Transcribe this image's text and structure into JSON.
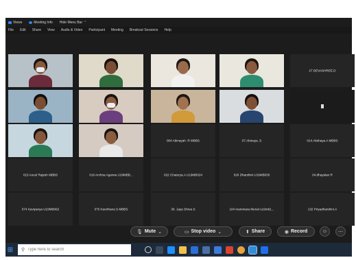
{
  "topbar": [
    {
      "label": "Views",
      "icon": "view-icon"
    },
    {
      "label": "Meeting Info",
      "icon": "shield-icon"
    },
    {
      "label": "Hide Menu Bar",
      "icon": "chevron-up-icon"
    }
  ],
  "menu": [
    "File",
    "Edit",
    "Share",
    "View",
    "Audio & Video",
    "Participant",
    "Meeting",
    "Breakout Sessions",
    "Help"
  ],
  "tiles": [
    {
      "name": "",
      "video": true
    },
    {
      "name": "",
      "video": true
    },
    {
      "name": "",
      "video": true
    },
    {
      "name": "",
      "video": true
    },
    {
      "name": "27 DEVASHREE.D",
      "video": false
    },
    {
      "name": "",
      "video": true
    },
    {
      "name": "",
      "video": true
    },
    {
      "name": "",
      "video": true
    },
    {
      "name": "",
      "video": true
    },
    {
      "name": "",
      "video": true
    },
    {
      "name": "",
      "video": true
    },
    {
      "name": "",
      "video": true
    },
    {
      "name": "004 Abinayah .R MBBS",
      "video": false
    },
    {
      "name": "07.Abinaya .S",
      "video": false
    },
    {
      "name": "014.Akshaya.A MBBS",
      "video": false
    },
    {
      "name": "015 Anuul Rajesh MBBS",
      "video": false
    },
    {
      "name": "016 Archna Agarwa U19MBB...",
      "video": false
    },
    {
      "name": "022 Chaturya.A U19MB024",
      "video": false
    },
    {
      "name": "026 Dharshini U19MB030",
      "video": false
    },
    {
      "name": "04.dhayalan R",
      "video": false
    },
    {
      "name": "074 Kaviyanya U19MB062",
      "video": false
    },
    {
      "name": "075 Keerthana S MBBS",
      "video": false
    },
    {
      "name": "30. Jaya Shree.S",
      "video": false
    },
    {
      "name": "104 mammara thenal u19mb1...",
      "video": false
    },
    {
      "name": "132 Priyadharshini.A",
      "video": false
    }
  ],
  "controls": {
    "mute": "Mute",
    "stop_video": "Stop video",
    "share": "Share",
    "record": "Record"
  },
  "taskbar": {
    "search_placeholder": "Type here to search"
  },
  "colors": {
    "meeting_bg": "#1c1c1c",
    "tile_bg": "#252525",
    "accent": "#3b82f6",
    "taskbar_bg": "#1d2a3a"
  }
}
